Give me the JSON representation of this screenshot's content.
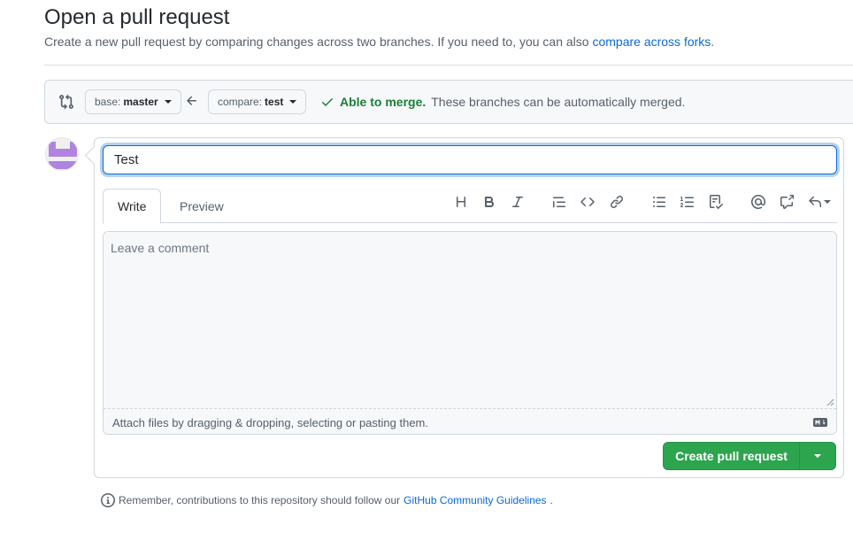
{
  "header": {
    "title": "Open a pull request",
    "subtitle": "Create a new pull request by comparing changes across two branches. If you need to, you can also ",
    "compare_forks_link": "compare across forks",
    "subtitle_end": "."
  },
  "range": {
    "base_prefix": "base:",
    "base_branch": "master",
    "compare_prefix": "compare:",
    "compare_branch": "test",
    "merge_ok": "Able to merge.",
    "merge_desc": "These branches can be automatically merged."
  },
  "form": {
    "title_value": "Test",
    "tabs": [
      {
        "label": "Write",
        "selected": true
      },
      {
        "label": "Preview",
        "selected": false
      }
    ],
    "toolbar_icons": [
      "heading-icon",
      "bold-icon",
      "italic-icon",
      "quote-icon",
      "code-icon",
      "link-icon",
      "unordered-list-icon",
      "ordered-list-icon",
      "task-list-icon",
      "mention-icon",
      "cross-reference-icon",
      "reply-icon"
    ],
    "comment_placeholder": "Leave a comment",
    "attach_text": "Attach files by dragging & dropping, selecting or pasting them.",
    "create_label": "Create pull request"
  },
  "footer": {
    "remember_text": "Remember, contributions to this repository should follow our ",
    "guidelines_link": "GitHub Community Guidelines",
    "remember_end": "."
  },
  "colors": {
    "accent": "#0969da",
    "success": "#1a7f37",
    "button_green": "#2da44e",
    "avatar": "#b083e0"
  }
}
